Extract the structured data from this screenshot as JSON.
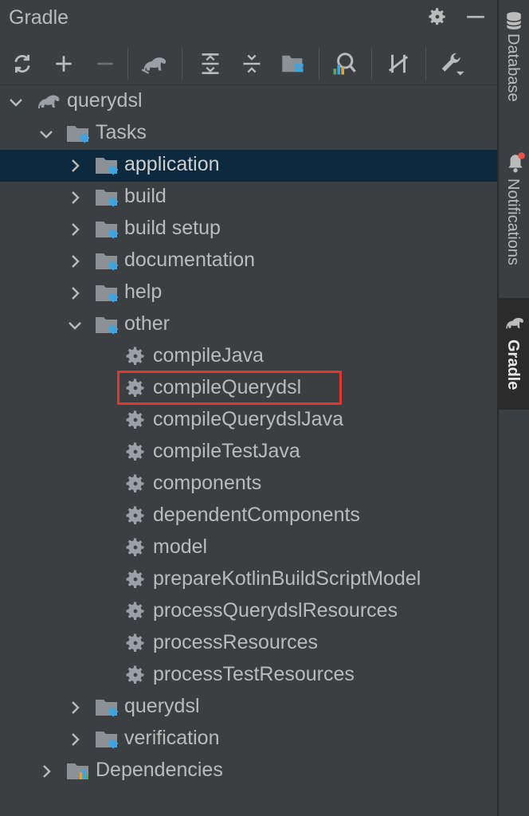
{
  "window": {
    "title": "Gradle"
  },
  "title_actions": [
    {
      "name": "settings-gear-icon"
    },
    {
      "name": "hide-minus-icon"
    }
  ],
  "toolbar": [
    {
      "name": "reload-icon"
    },
    {
      "name": "add-icon"
    },
    {
      "name": "remove-icon"
    },
    {
      "name": "execute-task-icon"
    },
    {
      "name": "expand-all-icon"
    },
    {
      "name": "collapse-all-icon"
    },
    {
      "name": "group-modules-icon"
    },
    {
      "name": "analyze-dependencies-icon"
    },
    {
      "name": "toggle-offline-icon"
    },
    {
      "name": "build-tool-settings-icon"
    }
  ],
  "tree": {
    "root": "querydsl",
    "tasks_folder": "Tasks",
    "groups": [
      "application",
      "build",
      "build setup",
      "documentation",
      "help",
      "other"
    ],
    "other_tasks": [
      "compileJava",
      "compileQuerydsl",
      "compileQuerydslJava",
      "compileTestJava",
      "components",
      "dependentComponents",
      "model",
      "prepareKotlinBuildScriptModel",
      "processQuerydslResources",
      "processResources",
      "processTestResources"
    ],
    "groups_after": [
      "querydsl",
      "verification"
    ],
    "dependencies": "Dependencies",
    "selected": "application",
    "highlighted": "compileQuerydsl"
  },
  "side_tabs": {
    "database": "Database",
    "notifications": "Notifications",
    "gradle": "Gradle",
    "active": "Gradle"
  },
  "colors": {
    "background": "#3c3f41",
    "selection": "#0d293e",
    "highlight_box": "#e0362b",
    "notification_dot": "#e5534b",
    "folder": "#8c9196",
    "gear_badge": "#3fa3e0"
  }
}
